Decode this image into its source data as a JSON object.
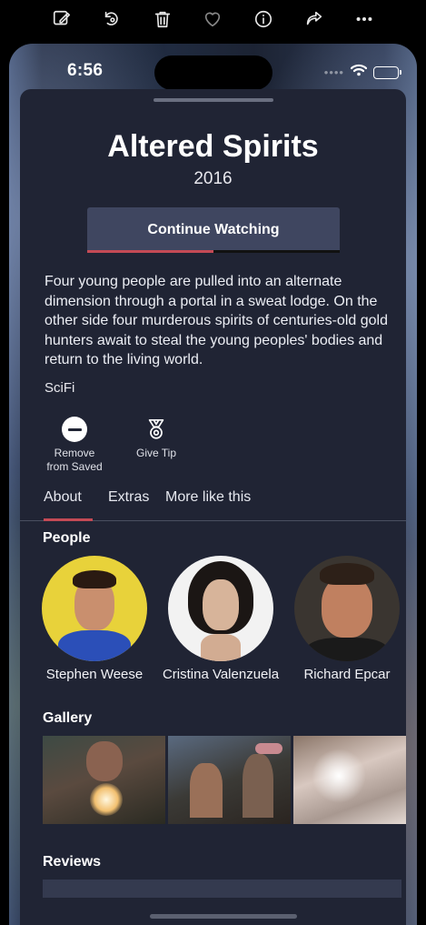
{
  "viewer_toolbar": {
    "icons": [
      "edit-icon",
      "rotate-icon",
      "trash-icon",
      "heart-icon",
      "info-icon",
      "share-icon",
      "more-icon"
    ]
  },
  "status": {
    "time": "6:56",
    "dots": "••••"
  },
  "movie": {
    "title": "Altered Spirits",
    "year": "2016",
    "continue_label": "Continue Watching",
    "progress": 0.5,
    "description": "Four young people are pulled into an alternate dimension through a portal in a sweat lodge. On the other side four murderous spirits of centuries-old gold hunters await to steal the young peoples' bodies and return to the living world.",
    "genre": "SciFi"
  },
  "actions": {
    "remove_label_1": "Remove",
    "remove_label_2": "from Saved",
    "tip_label": "Give Tip"
  },
  "tabs": [
    "About",
    "Extras",
    "More like this"
  ],
  "sections": {
    "people": "People",
    "gallery": "Gallery",
    "reviews": "Reviews"
  },
  "people": [
    "Stephen Weese",
    "Cristina Valenzuela",
    "Richard Epcar"
  ],
  "colors": {
    "sheet": "#202434",
    "accent": "#c44a55",
    "button": "#3f4660"
  }
}
